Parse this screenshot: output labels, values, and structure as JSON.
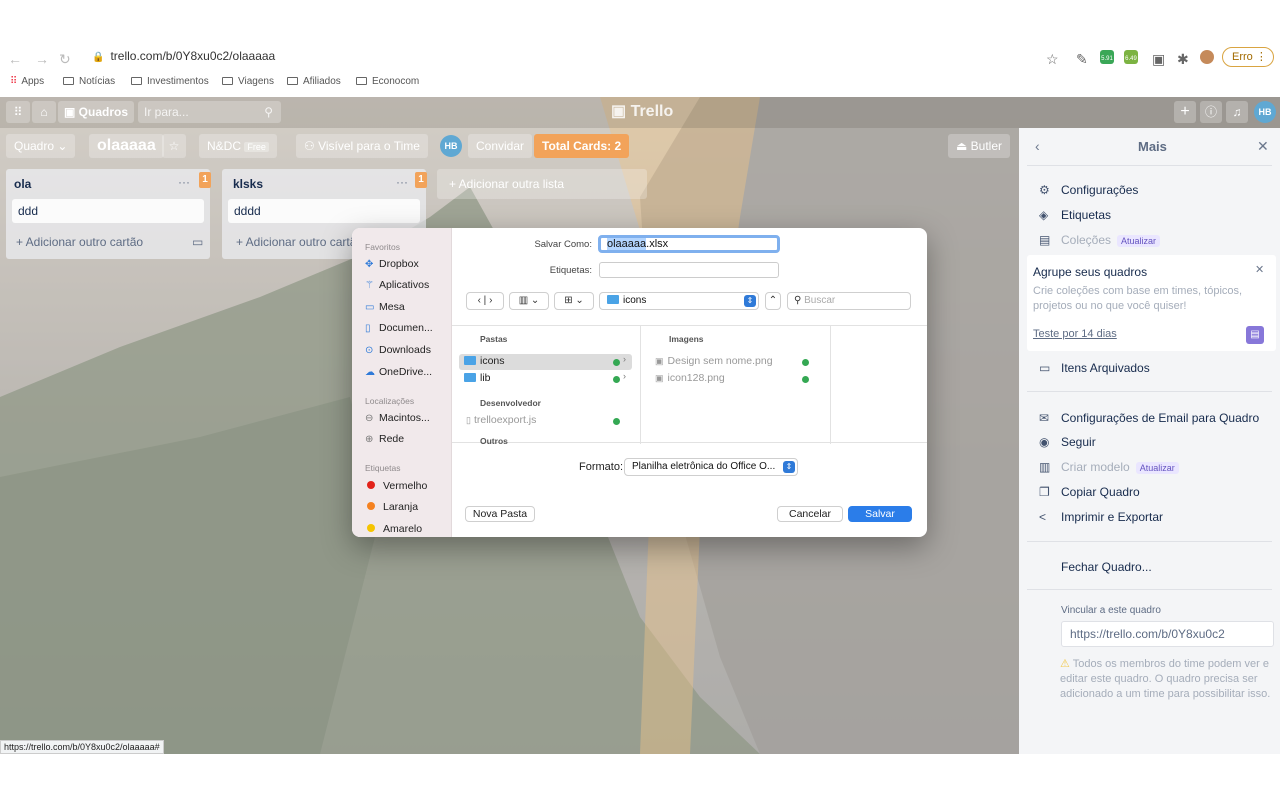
{
  "browser": {
    "url": "trello.com/b/0Y8xu0c2/olaaaaa",
    "error_label": "Erro",
    "status_url": "https://trello.com/b/0Y8xu0c2/olaaaaa#",
    "extensions": [
      "5.91",
      "6.49"
    ],
    "bookmarks": [
      "Apps",
      "Notícias",
      "Investimentos",
      "Viagens",
      "Afiliados",
      "Econocom"
    ]
  },
  "trello": {
    "logo": "Trello",
    "quadros": "Quadros",
    "search_placeholder": "Ir para...",
    "avatar": "HB",
    "board": {
      "view": "Quadro",
      "name": "olaaaaa",
      "team": "N&DC",
      "team_badge": "Free",
      "visibility": "Visível para o Time",
      "invite": "Convidar",
      "total_cards": "Total Cards: 2",
      "butler": "Butler"
    },
    "lists": [
      {
        "title": "ola",
        "badge": "1",
        "card": "ddd",
        "add": "+ Adicionar outro cartão"
      },
      {
        "title": "klsks",
        "badge": "1",
        "card": "dddd",
        "add": "+ Adicionar outro cartão"
      }
    ],
    "add_list": "+ Adicionar outra lista"
  },
  "menu": {
    "title": "Mais",
    "items": {
      "configuracoes": "Configurações",
      "etiquetas": "Etiquetas",
      "colecoes": "Coleções",
      "atualizar": "Atualizar",
      "group_title": "Agrupe seus quadros",
      "group_text": "Crie coleções com base em times, tópicos, projetos ou no que você quiser!",
      "trial": "Teste por 14 dias",
      "arquivados": "Itens Arquivados",
      "email": "Configurações de Email para Quadro",
      "seguir": "Seguir",
      "criar_modelo": "Criar modelo",
      "copiar": "Copiar Quadro",
      "imprimir": "Imprimir e Exportar",
      "fechar": "Fechar Quadro...",
      "vincular": "Vincular a este quadro",
      "link": "https://trello.com/b/0Y8xu0c2",
      "notice": "Todos os membros do time podem ver e editar este quadro. O quadro precisa ser adicionado a um time para possibilitar isso."
    }
  },
  "dialog": {
    "save_as_label": "Salvar Como:",
    "filename_selected": "olaaaaa",
    "filename_ext": ".xlsx",
    "tags_label": "Etiquetas:",
    "location": "icons",
    "search_placeholder": "Buscar",
    "sidebar": {
      "favorites_header": "Favoritos",
      "favorites": [
        "Dropbox",
        "Aplicativos",
        "Mesa",
        "Documen...",
        "Downloads",
        "OneDrive..."
      ],
      "locations_header": "Localizações",
      "locations": [
        "Macintos...",
        "Rede"
      ],
      "tags_header": "Etiquetas",
      "tags": [
        {
          "name": "Vermelho",
          "color": "#e2231a"
        },
        {
          "name": "Laranja",
          "color": "#f58220"
        },
        {
          "name": "Amarelo",
          "color": "#f5c400"
        }
      ]
    },
    "columns": {
      "pastas": "Pastas",
      "pastas_items": [
        "icons",
        "lib"
      ],
      "desenvolvedor": "Desenvolvedor",
      "dev_items": [
        "trelloexport.js"
      ],
      "outros": "Outros",
      "imagens": "Imagens",
      "image_items": [
        "Design sem nome.png",
        "icon128.png"
      ]
    },
    "format_label": "Formato:",
    "format_value": "Planilha eletrônica do Office O...",
    "new_folder": "Nova Pasta",
    "cancel": "Cancelar",
    "save": "Salvar"
  }
}
